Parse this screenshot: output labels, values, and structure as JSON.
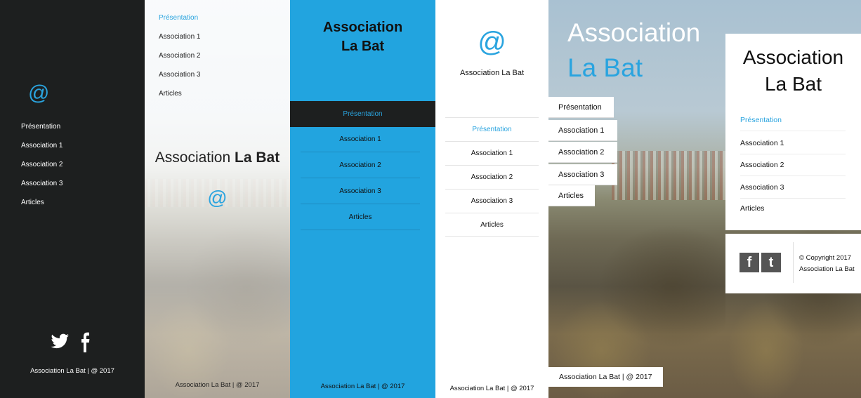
{
  "panel1": {
    "logo": "@",
    "nav": [
      "Présentation",
      "Association 1",
      "Association 2",
      "Association 3",
      "Articles"
    ],
    "social_icons": [
      "twitter-icon",
      "facebook-icon"
    ],
    "footer": "Association La Bat | @ 2017"
  },
  "panel2": {
    "nav": [
      "Présentation",
      "Association 1",
      "Association 2",
      "Association 3",
      "Articles"
    ],
    "title_light": "Association",
    "title_bold": "La Bat",
    "logo": "@",
    "footer": "Association La Bat | @ 2017"
  },
  "panel3": {
    "title_line1": "Association",
    "title_line2": "La Bat",
    "nav_active": "Présentation",
    "nav": [
      "Association 1",
      "Association 2",
      "Association 3",
      "Articles"
    ],
    "footer": "Association La Bat | @ 2017"
  },
  "panel4": {
    "logo": "@",
    "brand": "Association La Bat",
    "nav_active": "Présentation",
    "nav": [
      "Association 1",
      "Association 2",
      "Association 3",
      "Articles"
    ],
    "footer": "Association La Bat | @ 2017"
  },
  "panel5": {
    "title_line1": "Association",
    "title_line2": "La Bat",
    "nav": [
      "Présentation",
      "Association 1",
      "Association 2",
      "Association 3",
      "Articles"
    ],
    "footer": "Association La Bat | @ 2017"
  },
  "panel6": {
    "title_line1": "Association",
    "title_line2": "La Bat",
    "nav_active": "Présentation",
    "nav": [
      "Association 1",
      "Association 2",
      "Association 3",
      "Articles"
    ],
    "icon_f": "f",
    "icon_t": "t",
    "copyright": "© Copyright 2017",
    "copyright_org": "Association La Bat"
  },
  "colors": {
    "accent": "#2aa4df",
    "dark": "#1d1f1f",
    "blue_panel": "#22a4df"
  }
}
